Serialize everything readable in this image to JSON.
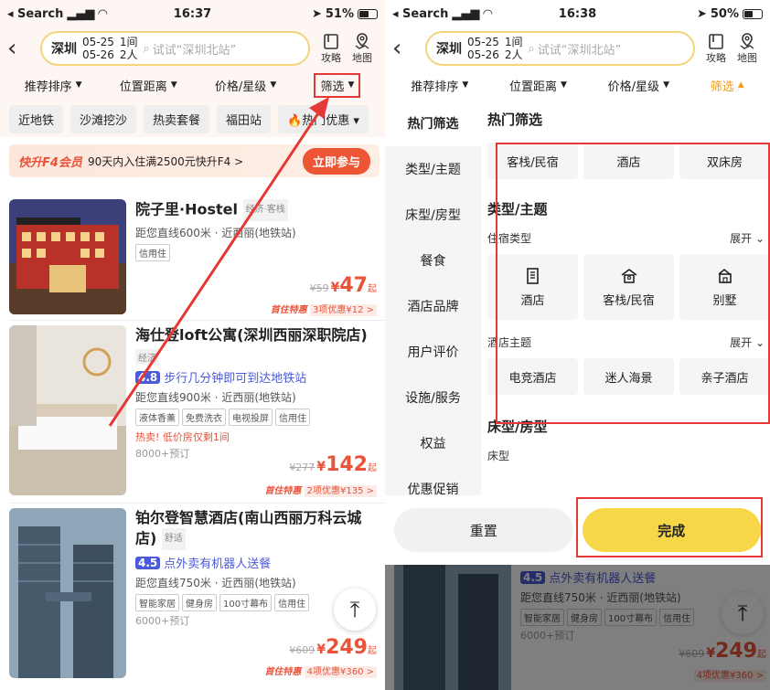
{
  "left": {
    "status": {
      "back_label": "◂ Search",
      "time": "16:37",
      "battery": "51%"
    },
    "header": {
      "city": "深圳",
      "date_in": "05-25",
      "date_out": "05-26",
      "nights": "1间",
      "guests": "2人",
      "search_placeholder": "试试“深圳北站”",
      "guide_label": "攻略",
      "map_label": "地图"
    },
    "sort": {
      "items": [
        "推荐排序",
        "位置距离",
        "价格/星级",
        "筛选"
      ]
    },
    "tags": [
      "近地铁",
      "沙滩挖沙",
      "热卖套餐",
      "福田站",
      "热门优惠"
    ],
    "banner": {
      "title": "快升F4会员",
      "text": "90天内入住满2500元快升F4 >",
      "button": "立即参与"
    },
    "hotels": [
      {
        "name": "院子里·Hostel",
        "level": "经济·客栈",
        "distance": "距您直线600米 · 近西丽(地铁站)",
        "chips": [
          "信用住"
        ],
        "old_price": "¥59",
        "price": "47",
        "suffix": "起",
        "deal_a": "首住特惠",
        "deal_b": "3项优惠¥12 >"
      },
      {
        "name": "海仕登loft公寓(深圳西丽深职院店)",
        "level": "经济",
        "rating": "4.8",
        "rating_text": "步行几分钟即可到达地铁站",
        "distance": "距您直线900米 · 近西丽(地铁站)",
        "chips": [
          "液体香薰",
          "免费洗衣",
          "电视投屏",
          "信用住"
        ],
        "hot": "热卖! 低价房仅剩1间",
        "booked": "8000+预订",
        "old_price": "¥277",
        "price": "142",
        "suffix": "起",
        "deal_a": "首住特惠",
        "deal_b": "2项优惠¥135 >"
      },
      {
        "name": "铂尔登智慧酒店(南山西丽万科云城店)",
        "level": "舒适",
        "rating": "4.5",
        "rating_text": "点外卖有机器人送餐",
        "distance": "距您直线750米 · 近西丽(地铁站)",
        "chips": [
          "智能家居",
          "健身房",
          "100寸幕布",
          "信用住"
        ],
        "booked": "6000+预订",
        "old_price": "¥609",
        "price": "249",
        "suffix": "起",
        "deal_a": "首住特惠",
        "deal_b": "4项优惠¥360 >"
      }
    ],
    "fab": "⌅"
  },
  "right": {
    "status": {
      "back_label": "◂ Search",
      "time": "16:38",
      "battery": "50%"
    },
    "sort": {
      "items": [
        "推荐排序",
        "位置距离",
        "价格/星级",
        "筛选"
      ]
    },
    "nav": [
      "热门筛选",
      "类型/主题",
      "床型/房型",
      "餐食",
      "酒店品牌",
      "用户评价",
      "设施/服务",
      "权益",
      "优惠促销"
    ],
    "content": {
      "hot_title": "热门筛选",
      "hot_items": [
        "客栈/民宿",
        "酒店",
        "双床房"
      ],
      "type_title": "类型/主题",
      "stay_type": "住宿类型",
      "expand": "展开",
      "stay_items": [
        {
          "label": "酒店",
          "icon": "hotel-icon"
        },
        {
          "label": "客栈/民宿",
          "icon": "inn-icon"
        },
        {
          "label": "别墅",
          "icon": "villa-icon"
        }
      ],
      "theme": "酒店主题",
      "theme_items": [
        "电竞酒店",
        "迷人海景",
        "亲子酒店"
      ],
      "bed_title": "床型/房型",
      "bed_sub": "床型"
    },
    "buttons": {
      "reset": "重置",
      "done": "完成"
    },
    "bg_hotel": {
      "rating": "4.5",
      "rating_text": "点外卖有机器人送餐",
      "distance": "距您直线750米 · 近西丽(地铁站)",
      "chips": [
        "智能家居",
        "健身房",
        "100寸幕布",
        "信用住"
      ],
      "booked": "6000+预订",
      "old_price": "¥609",
      "price": "249",
      "suffix": "起",
      "deal_b": "4项优惠¥360 >"
    }
  },
  "colors": {
    "accent_red": "#e53935",
    "price_orange": "#e8533a",
    "done_yellow": "#f7d648",
    "filter_orange": "#f49a1c"
  }
}
